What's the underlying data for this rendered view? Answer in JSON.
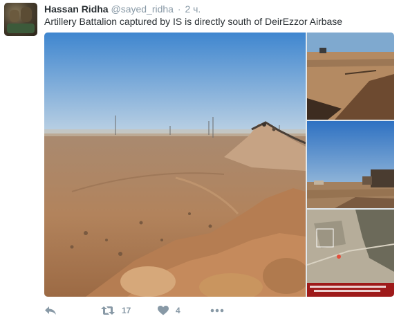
{
  "tweet": {
    "author_name": "Hassan Ridha",
    "author_handle": "@sayed_ridha",
    "separator": "·",
    "timestamp": "2 ч.",
    "text": "Artillery Battalion captured by IS is directly south of DeirEzzor Airbase"
  },
  "media": {
    "photo_count": 4
  },
  "actions": {
    "reply_icon": "reply-icon",
    "retweet_icon": "retweet-icon",
    "retweet_count": "17",
    "like_icon": "heart-icon",
    "like_count": "4",
    "more_icon": "more-dots-icon"
  },
  "colors": {
    "text_primary": "#292f33",
    "text_secondary": "#8899a6",
    "sky": "#4a8fd0",
    "sand": "#b07a4e"
  }
}
